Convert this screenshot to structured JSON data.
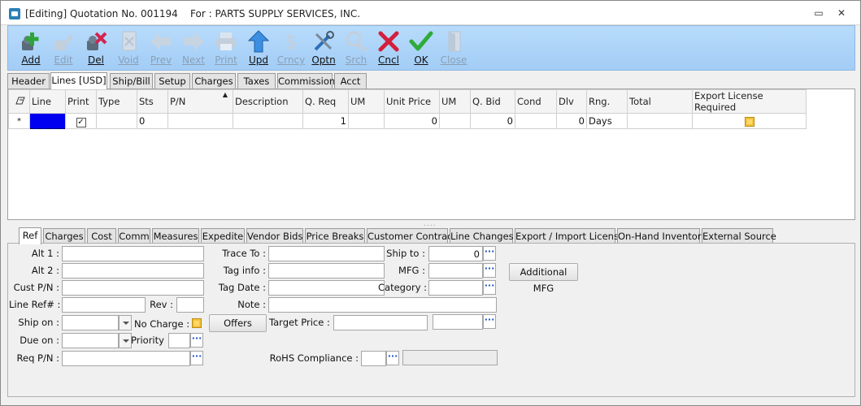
{
  "window": {
    "title": "[Editing] Quotation No. 001194    For : PARTS SUPPLY SERVICES, INC.",
    "minimize": "▭",
    "close": "✕"
  },
  "toolbar": {
    "buttons": [
      {
        "label": "Add",
        "icon": "add-icon",
        "enabled": true
      },
      {
        "label": "Edit",
        "icon": "edit-icon",
        "enabled": false
      },
      {
        "label": "Del",
        "icon": "delete-icon",
        "enabled": true
      },
      {
        "label": "Void",
        "icon": "void-icon",
        "enabled": false
      },
      {
        "label": "Prev",
        "icon": "prev-icon",
        "enabled": false
      },
      {
        "label": "Next",
        "icon": "next-icon",
        "enabled": false
      },
      {
        "label": "Print",
        "icon": "print-icon",
        "enabled": false
      },
      {
        "label": "Upd",
        "icon": "update-icon",
        "enabled": true
      },
      {
        "label": "Crncy",
        "icon": "currency-icon",
        "enabled": false
      },
      {
        "label": "Optn",
        "icon": "options-icon",
        "enabled": true
      },
      {
        "label": "Srch",
        "icon": "search-icon",
        "enabled": false
      },
      {
        "label": "Cncl",
        "icon": "cancel-icon",
        "enabled": true
      },
      {
        "label": "OK",
        "icon": "ok-icon",
        "enabled": true
      },
      {
        "label": "Close",
        "icon": "close-door-icon",
        "enabled": false
      }
    ]
  },
  "top_tabs": [
    "Header",
    "Lines [USD]",
    "Ship/Bill",
    "Setup",
    "Charges",
    "Taxes",
    "Commission",
    "Acct"
  ],
  "grid": {
    "columns": [
      "Line",
      "Print",
      "Type",
      "Sts",
      "P/N",
      "Description",
      "Q. Req",
      "UM",
      "Unit Price",
      "UM",
      "Q. Bid",
      "Cond",
      "Dlv",
      "Rng.",
      "Total",
      "Export License Required"
    ],
    "row": {
      "marker": "*",
      "sts": "0",
      "q_req": "1",
      "unit_price": "0",
      "q_bid": "0",
      "dlv": "0",
      "rng": "Days"
    }
  },
  "splitter": "....",
  "bottom_tabs": [
    "Ref",
    "Charges",
    "Cost",
    "Comm",
    "Measures",
    "Expedite",
    "Vendor Bids",
    "Price Breaks",
    "Customer Contract",
    "Line Changes",
    "Export / Import License",
    "On-Hand Inventory",
    "External Source"
  ],
  "form": {
    "alt1": "Alt 1 :",
    "alt2": "Alt 2 :",
    "cust_pn": "Cust P/N :",
    "line_ref": "Line Ref# :",
    "rev": "Rev :",
    "ship_on": "Ship on :",
    "due_on": "Due on :",
    "req_pn": "Req P/N :",
    "no_charge": "No Charge :",
    "priority": "Priority :",
    "offers": "Offers",
    "trace_to": "Trace To :",
    "tag_info": "Tag info :",
    "tag_date": "Tag Date :",
    "note": "Note :",
    "target_price": "Target Price :",
    "rohs": "RoHS Compliance :",
    "ship_to": "Ship to :",
    "ship_to_value": "0",
    "mfg": "MFG :",
    "category": "Category :",
    "additional_mfg": "Additional MFG",
    "dots": "···"
  }
}
